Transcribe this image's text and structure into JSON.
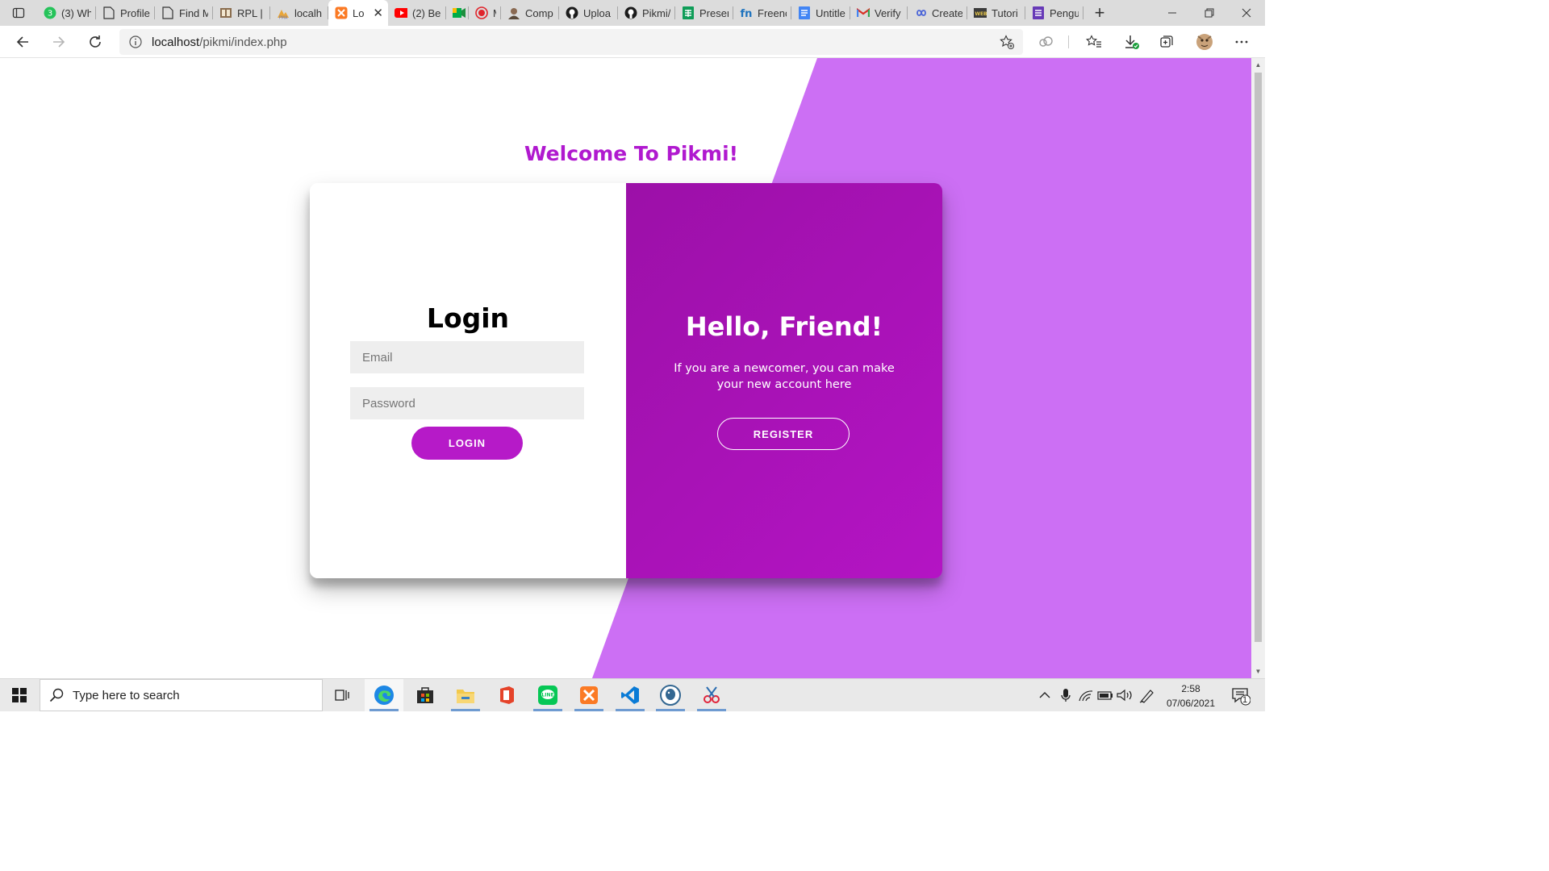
{
  "browser": {
    "tabs": [
      {
        "title": "(3) Wh",
        "icon": "whatsapp-icon"
      },
      {
        "title": "Profile",
        "icon": "page-icon"
      },
      {
        "title": "Find M",
        "icon": "page-icon"
      },
      {
        "title": "RPL | T",
        "icon": "book-icon"
      },
      {
        "title": "localh",
        "icon": "phpmyadmin-icon"
      },
      {
        "title": "Lo",
        "icon": "xampp-icon",
        "active": true
      },
      {
        "title": "(2) Be",
        "icon": "youtube-icon"
      },
      {
        "title": "",
        "icon": "meet-icon"
      },
      {
        "title": "M",
        "icon": "record-icon"
      },
      {
        "title": "Comp",
        "icon": "avatar-icon"
      },
      {
        "title": "Uploa",
        "icon": "github-icon"
      },
      {
        "title": "Pikmi/",
        "icon": "github-icon"
      },
      {
        "title": "Preser",
        "icon": "sheets-icon"
      },
      {
        "title": "Freenc",
        "icon": "freenom-icon"
      },
      {
        "title": "Untitle",
        "icon": "docs-icon"
      },
      {
        "title": "Verify",
        "icon": "gmail-icon"
      },
      {
        "title": "Create",
        "icon": "infinity-icon"
      },
      {
        "title": "Tutori",
        "icon": "w3schools-icon"
      },
      {
        "title": "Pengu",
        "icon": "forms-icon"
      }
    ],
    "url_host": "localhost",
    "url_path": "/pikmi/index.php"
  },
  "page": {
    "welcome": "Welcome To Pikmi!",
    "login": {
      "title": "Login",
      "email_placeholder": "Email",
      "password_placeholder": "Password",
      "button": "LOGIN"
    },
    "register": {
      "title": "Hello, Friend!",
      "text": "If you are a newcomer, you can make your new account here",
      "button": "REGISTER"
    }
  },
  "colors": {
    "accent": "#b019cf",
    "diagonal_background": "#cc6ff4",
    "panel_gradient_start": "#9c10a8",
    "panel_gradient_end": "#b414c4"
  },
  "taskbar": {
    "search_placeholder": "Type here to search",
    "apps": [
      "task-view-icon",
      "edge-icon",
      "store-icon",
      "file-explorer-icon",
      "office-icon",
      "line-icon",
      "xampp-icon",
      "vscode-icon",
      "postgres-icon",
      "snipping-icon"
    ],
    "time": "2:58",
    "date": "07/06/2021",
    "notifications": "1"
  }
}
